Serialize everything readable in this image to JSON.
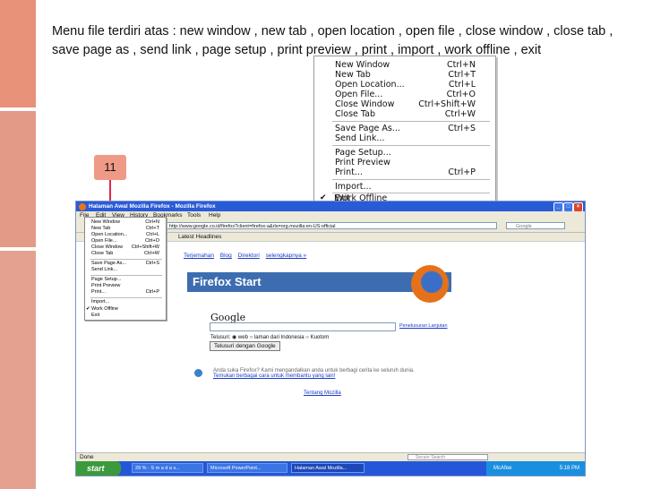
{
  "slide": {
    "text": "Menu file terdiri atas : new window , new tab , open location , open file , close window , close tab , save page as , send link , page setup , print preview , print , import , work offline , exit",
    "callout": "11"
  },
  "file_menu": [
    {
      "label": "New Window",
      "shortcut": "Ctrl+N"
    },
    {
      "label": "New Tab",
      "shortcut": "Ctrl+T"
    },
    {
      "label": "Open Location...",
      "shortcut": "Ctrl+L"
    },
    {
      "label": "Open File...",
      "shortcut": "Ctrl+O"
    },
    {
      "label": "Close Window",
      "shortcut": "Ctrl+Shift+W"
    },
    {
      "label": "Close Tab",
      "shortcut": "Ctrl+W"
    },
    {
      "label": "Save Page As...",
      "shortcut": "Ctrl+S"
    },
    {
      "label": "Send Link...",
      "shortcut": ""
    },
    {
      "label": "Page Setup...",
      "shortcut": ""
    },
    {
      "label": "Print Preview",
      "shortcut": ""
    },
    {
      "label": "Print...",
      "shortcut": "Ctrl+P"
    },
    {
      "label": "Import...",
      "shortcut": ""
    },
    {
      "label": "Work Offline",
      "shortcut": "",
      "checked": true
    },
    {
      "label": "Exit",
      "shortcut": ""
    }
  ],
  "browser": {
    "title": "Halaman Awal Mozilla Firefox - Mozilla Firefox",
    "menubar": [
      "File",
      "Edit",
      "View",
      "History",
      "Bookmarks",
      "Tools",
      "Help"
    ],
    "url": "http://www.google.co.id/firefox?client=firefox-a&rls=org.mozilla:en-US:official",
    "search_placeholder": "Google",
    "bookmark_item": "Latest Headlines",
    "links": [
      "Terjemahan",
      "Blog",
      "Direktori",
      "selengkapnya »"
    ],
    "brand": "Firefox Start",
    "google_logo": "Google",
    "advanced_search": "Penelusuran Lanjutan",
    "radio_label": "Telusuri:",
    "radio_options": [
      "web",
      "laman dari Indonesia",
      "Kuotom"
    ],
    "search_button": "Telusuri dengan Google",
    "promo_text": "Anda suka Firefox? Kami mengandalkan anda untuk berbagi cerita ke seluruh dunia.",
    "promo_link": "Temukan berbagai cara untuk membantu yang lain!",
    "about_link": "Tentang Mozilla",
    "status": "Done",
    "status_search": "Secure Search",
    "taskbar_start": "start",
    "taskbar_items": [
      "29 % - S m a d a v...",
      "Microsoft PowerPoint...",
      "Halaman Awal Mozilla..."
    ],
    "tray_brand": "McAfee",
    "clock": "5:18 PM"
  },
  "window_buttons": [
    "_",
    "□",
    "×"
  ],
  "colors": {
    "accent_bar": "#e8927a",
    "callout": "#ef9a86",
    "arrow": "#e0264e",
    "titlebar": "#2a5bd7"
  }
}
